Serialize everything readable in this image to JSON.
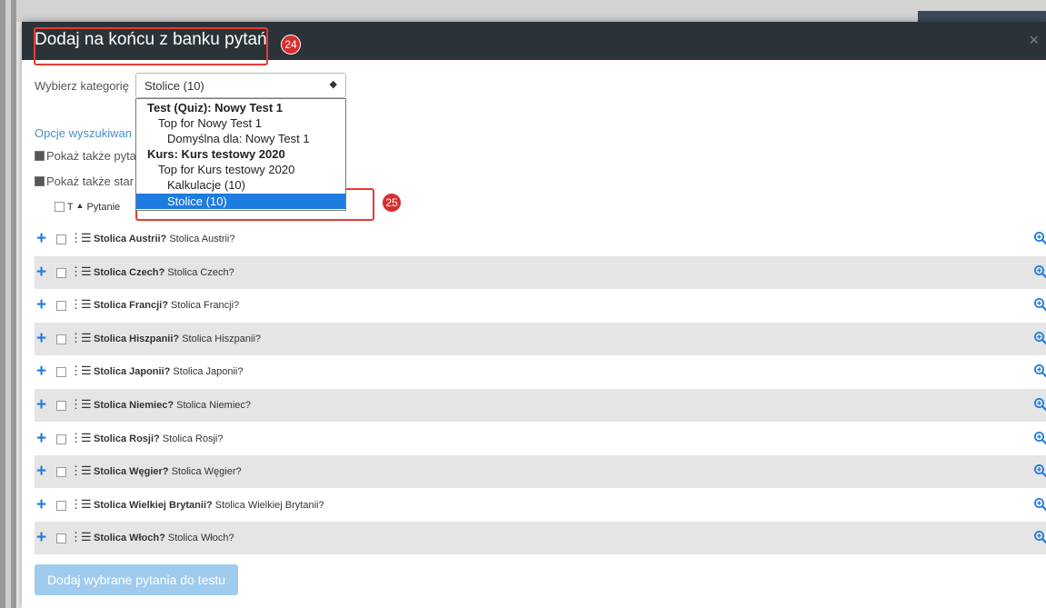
{
  "dialog": {
    "title": "Dodaj na końcu z banku pytań",
    "close_symbol": "×"
  },
  "category": {
    "label": "Wybierz kategorię",
    "selected": "Stolice (10)",
    "options": [
      {
        "label": "Test (Quiz): Nowy Test 1",
        "kind": "group"
      },
      {
        "label": "Top for Nowy Test 1",
        "kind": "level1"
      },
      {
        "label": "Domyślna dla: Nowy Test 1",
        "kind": "level2"
      },
      {
        "label": "Kurs: Kurs testowy 2020",
        "kind": "group"
      },
      {
        "label": "Top for Kurs testowy 2020",
        "kind": "level1"
      },
      {
        "label": "Kalkulacje (10)",
        "kind": "level2"
      },
      {
        "label": "Stolice (10)",
        "kind": "level2",
        "selected": true
      }
    ]
  },
  "search_options": {
    "link": "Opcje wyszukiwan",
    "show_subcategory": "Pokaż także pyta",
    "show_old": "Pokaż także star"
  },
  "table": {
    "col_type": "T",
    "col_question": "Pytanie"
  },
  "questions": [
    {
      "name": "Stolica Austrii?",
      "text": "Stolica Austrii?"
    },
    {
      "name": "Stolica Czech?",
      "text": "Stolica Czech?"
    },
    {
      "name": "Stolica Francji?",
      "text": "Stolica Francji?"
    },
    {
      "name": "Stolica Hiszpanii?",
      "text": "Stolica Hiszpanii?"
    },
    {
      "name": "Stolica Japonii?",
      "text": "Stolica Japonii?"
    },
    {
      "name": "Stolica Niemiec?",
      "text": "Stolica Niemiec?"
    },
    {
      "name": "Stolica Rosji?",
      "text": "Stolica Rosji?"
    },
    {
      "name": "Stolica Węgier?",
      "text": "Stolica Węgier?"
    },
    {
      "name": "Stolica Wielkiej Brytanii?",
      "text": "Stolica Wielkiej Brytanii?"
    },
    {
      "name": "Stolica Włoch?",
      "text": "Stolica Włoch?"
    }
  ],
  "add_button": "Dodaj wybrane pytania do testu",
  "callouts": {
    "title": "24",
    "option": "25"
  },
  "colors": {
    "header_bg": "#2b3338",
    "accent_blue": "#1e7ce0",
    "callout_red": "#d32f2f",
    "button_disabled": "#9fcbee",
    "row_alt": "#e5e5e5"
  },
  "icons": {
    "add": "plus-icon",
    "question_type": "list-icon",
    "preview": "zoom-in-icon",
    "sort": "sort-up-icon"
  }
}
